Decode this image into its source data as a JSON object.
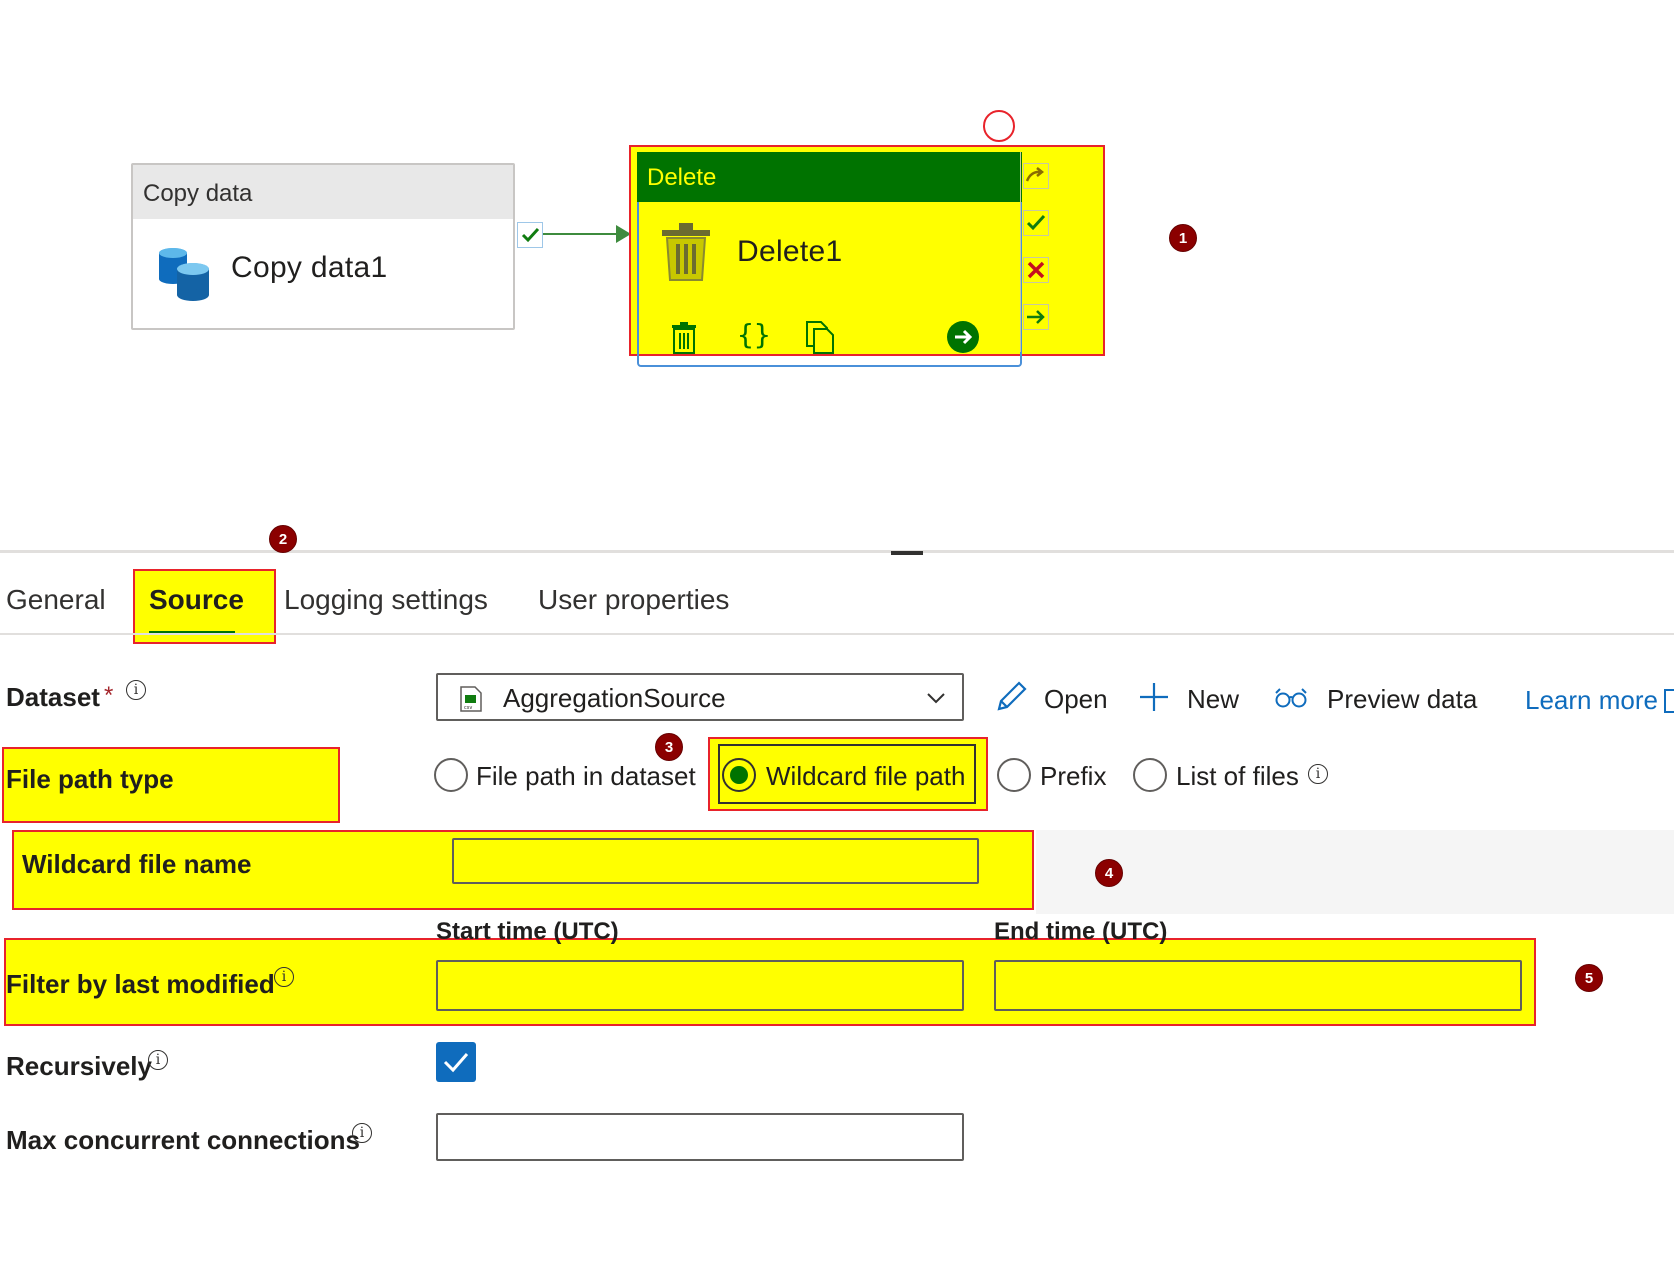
{
  "canvas": {
    "copy_activity": {
      "type_label": "Copy data",
      "name": "Copy data1",
      "icon": "database-icon"
    },
    "delete_activity": {
      "type_label": "Delete",
      "name": "Delete1",
      "icon": "trash-icon"
    },
    "delete_actions": [
      "trash-icon",
      "code-braces-icon",
      "copy-icon",
      "go-arrow-icon"
    ],
    "dependency_icons": [
      "skip-icon",
      "success-check-icon",
      "fail-x-icon",
      "completion-arrow-icon"
    ]
  },
  "badges": {
    "b1": "1",
    "b2": "2",
    "b3": "3",
    "b4": "4",
    "b5": "5"
  },
  "tabs": [
    {
      "label": "General"
    },
    {
      "label": "Source"
    },
    {
      "label": "Logging settings"
    },
    {
      "label": "User properties"
    }
  ],
  "form": {
    "dataset": {
      "label": "Dataset",
      "required_mark": "*",
      "value": "AggregationSource",
      "open_label": "Open",
      "new_label": "New",
      "preview_label": "Preview data",
      "learn_more": "Learn more"
    },
    "file_path_type": {
      "label": "File path type",
      "options": [
        "File path in dataset",
        "Wildcard file path",
        "Prefix",
        "List of files"
      ],
      "selected": "Wildcard file path"
    },
    "wildcard_file_name": {
      "label": "Wildcard file name",
      "value": ""
    },
    "filter_last_modified": {
      "label": "Filter by last modified",
      "start_label": "Start time (UTC)",
      "end_label": "End time (UTC)",
      "start_value": "",
      "end_value": ""
    },
    "recursively": {
      "label": "Recursively",
      "checked": true
    },
    "max_connections": {
      "label": "Max concurrent connections",
      "value": ""
    }
  },
  "colors": {
    "highlight": "#ffff00",
    "annotation_red": "#e8232b",
    "activity_green": "#007300",
    "accent_blue": "#0f6cbd"
  }
}
